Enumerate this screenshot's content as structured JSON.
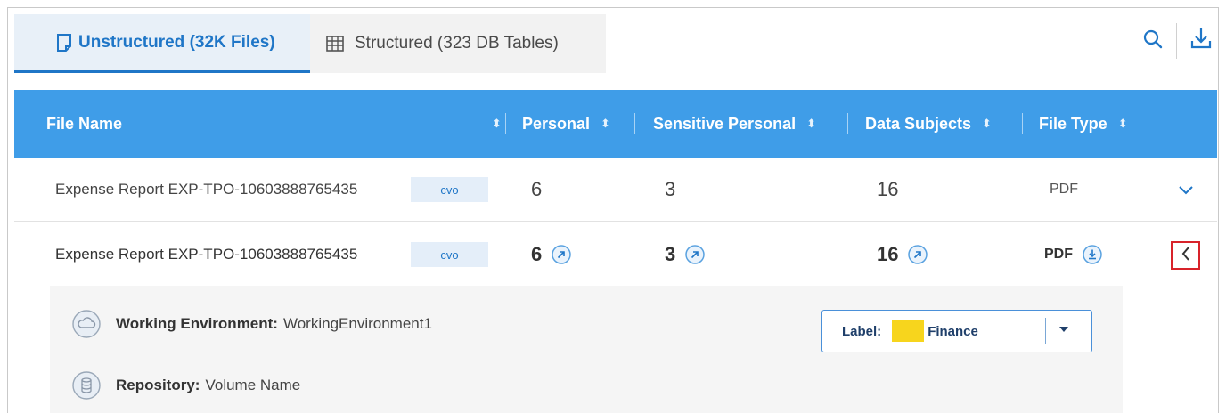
{
  "tabs": [
    {
      "label": "Unstructured (32K Files)",
      "icon": "document-icon",
      "active": true
    },
    {
      "label": "Structured (323 DB Tables)",
      "icon": "table-icon",
      "active": false
    }
  ],
  "toolbar": {
    "search_icon": "search-icon",
    "download_icon": "download-icon"
  },
  "table": {
    "columns": [
      {
        "label": "File Name",
        "sort": "⬍"
      },
      {
        "label": "Personal",
        "sort": "⬍"
      },
      {
        "label": "Sensitive Personal",
        "sort": "⬍"
      },
      {
        "label": "Data Subjects",
        "sort": "⬍"
      },
      {
        "label": "File Type",
        "sort": "⬍"
      }
    ],
    "rows": [
      {
        "file_name": "Expense Report EXP-TPO-10603888765435",
        "badge": "cvo",
        "personal": "6",
        "sensitive": "3",
        "subjects": "16",
        "file_type": "PDF",
        "expanded": false
      },
      {
        "file_name": "Expense Report EXP-TPO-10603888765435",
        "badge": "cvo",
        "personal": "6",
        "sensitive": "3",
        "subjects": "16",
        "file_type": "PDF",
        "expanded": true
      }
    ]
  },
  "details": {
    "working_env_label": "Working Environment:",
    "working_env_value": "WorkingEnvironment1",
    "repository_label": "Repository:",
    "repository_value": "Volume Name",
    "label_key": "Label:",
    "label_value": "Finance",
    "label_color": "#f7d51d"
  },
  "colors": {
    "accent": "#1f76c7",
    "header": "#3f9de8",
    "highlight": "#d8232a"
  }
}
